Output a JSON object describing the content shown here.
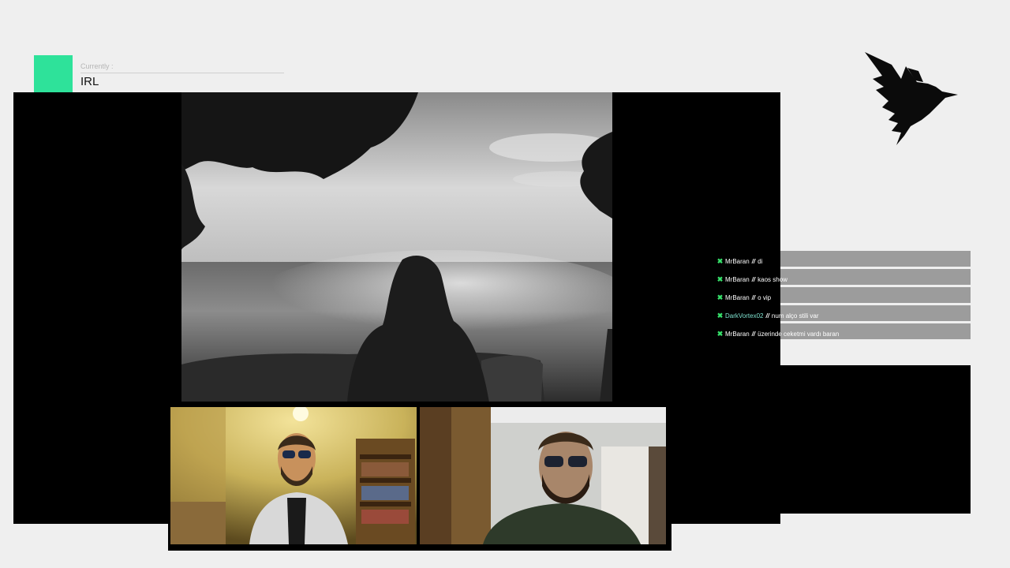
{
  "header": {
    "category_caption": "Currently :",
    "category_value": "IRL",
    "accent_color": "#2ee29a"
  },
  "logo": {
    "icon": "bird-logo-icon"
  },
  "chat": {
    "messages": [
      {
        "user": "MrBaran",
        "separator": "//",
        "text": "di"
      },
      {
        "user": "MrBaran",
        "separator": "//",
        "text": "kaos show"
      },
      {
        "user": "MrBaran",
        "separator": "//",
        "text": "o vip"
      },
      {
        "user": "DarkVortex02",
        "separator": "//",
        "text": "num alço stili var"
      },
      {
        "user": "MrBaran",
        "separator": "//",
        "text": "üzerinde ceketmi vardı baran"
      }
    ],
    "badge_icon": "x-badge-icon",
    "badge_color": "#36e06a"
  },
  "media": {
    "main_photo": "grayscale-seascape-photo",
    "webcam_left": "webcam-left",
    "webcam_right": "webcam-right"
  }
}
